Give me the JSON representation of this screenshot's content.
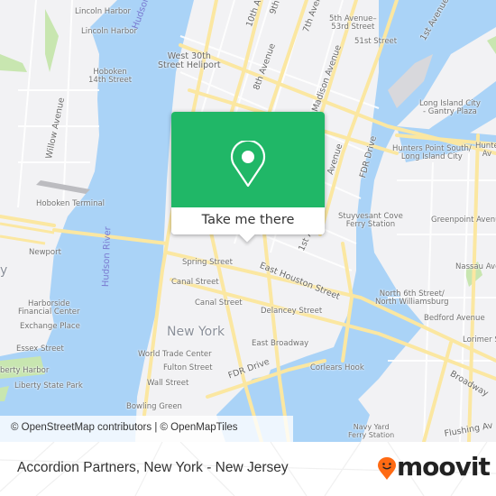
{
  "map": {
    "colors": {
      "water": "#aad3f7",
      "land": "#f2f2f4",
      "road_major": "#fbe7a1",
      "park": "#c8e6b0",
      "accent": "#20b767",
      "brand": "#ff6a13"
    },
    "labels": {
      "lincoln_harbor_1": "Lincoln Harbor",
      "lincoln_harbor_2": "Lincoln Harbor",
      "hoboken_14th": "Hoboken\n14th Street",
      "hudson_river_top": "Hudson River",
      "west_30th": "West 30th\nStreet Heliport",
      "willow_ave": "Willow Avenue",
      "hoboken_terminal": "Hoboken Terminal",
      "tenth_ave": "10th Av",
      "ninth_ave": "9th",
      "seventh_ave": "7th Avenue",
      "eighth_ave": "8th Avenue",
      "madison_ave": "Madison Avenue",
      "fifth_ave_53": "5th Avenue–\n53rd Street",
      "st51": "51st Street",
      "first_ave_top": "1st Avenue",
      "lic_gantry": "Long Island City\n- Gantry Plaza",
      "hunters_point": "Hunters Point South/\nLong Island City",
      "hunters_ave": "Hunte\nAv",
      "fdr_drive_top": "FDR Drive",
      "avenue_mid": "Avenue",
      "stuyvesant": "Stuyvesant Cove\nFerry Station",
      "greenpoint_ave": "Greenpoint Avenue",
      "nassau_ave": "Nassau Ave",
      "newport": "Newport",
      "hudson_river_mid": "Hudson River",
      "jersey_city": "y",
      "harborside": "Harborside\nFinancial Center",
      "exchange_place": "Exchange Place",
      "essex_street": "Essex Street",
      "liberty_harbor": "berty Harbor",
      "liberty_state_park": "Liberty State Park",
      "spring_street": "Spring Street",
      "canal_street_1": "Canal Street",
      "canal_street_2": "Canal Street",
      "new_york": "New York",
      "wtc": "World Trade Center",
      "fulton": "Fulton Street",
      "wall_street": "Wall Street",
      "bowling_green": "Bowling Green",
      "east_houston": "East Houston Street",
      "first_ave_mid": "1st A",
      "delancey": "Delancey Street",
      "east_broadway": "East Broadway",
      "fdr_drive_bottom": "FDR Drive",
      "corlears_hook": "Corlears Hook",
      "n6th_street": "North 6th Street/\nNorth Williamsburg",
      "bedford_ave": "Bedford Avenue",
      "lorimer": "Lorimer S",
      "broadway": "Broadway",
      "navy_yard": "Navy Yard\nFerry Station",
      "flushing_ave": "Flushing Av"
    },
    "attribution": "© OpenStreetMap contributors | © OpenMapTiles"
  },
  "popup": {
    "icon": "map-pin-icon",
    "button_label": "Take me there"
  },
  "footer": {
    "title": "Accordion Partners, New York - New Jersey",
    "brand": "moovit"
  }
}
